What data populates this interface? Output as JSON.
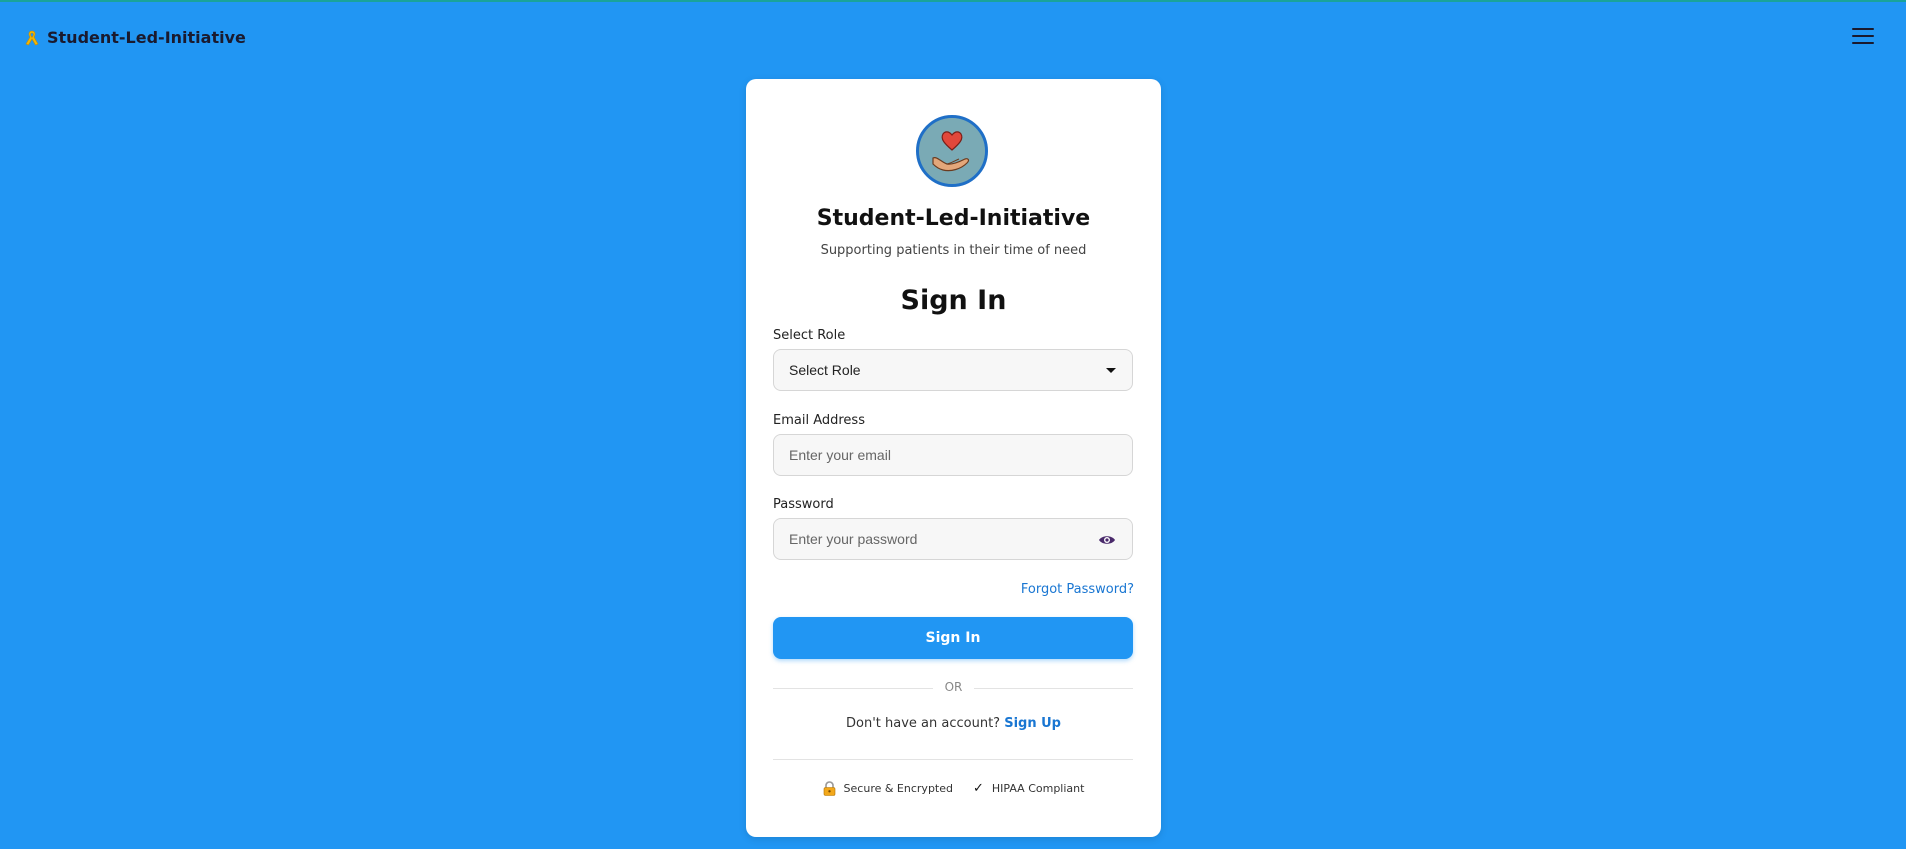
{
  "header": {
    "brand_name": "Student-Led-Initiative",
    "brand_icon": "awareness-ribbon-icon",
    "menu_icon": "hamburger-menu-icon"
  },
  "card": {
    "logo_icon": "heart-in-hand-icon",
    "app_title": "Student-Led-Initiative",
    "tagline": "Supporting patients in their time of need",
    "heading": "Sign In"
  },
  "form": {
    "role": {
      "label": "Select Role",
      "selected": "Select Role"
    },
    "email": {
      "label": "Email Address",
      "placeholder": "Enter your email",
      "value": ""
    },
    "password": {
      "label": "Password",
      "placeholder": "Enter your password",
      "value": "",
      "toggle_icon": "eye-icon"
    },
    "forgot_link": "Forgot Password?",
    "submit_label": "Sign In"
  },
  "alt": {
    "or_text": "OR",
    "signup_prompt": "Don't have an account?",
    "signup_link": "Sign Up"
  },
  "badges": {
    "secure": {
      "icon": "lock-icon",
      "text": "Secure & Encrypted"
    },
    "hipaa": {
      "icon": "check-icon",
      "text": "HIPAA Compliant"
    }
  },
  "colors": {
    "background": "#2196f3",
    "primary": "#2196f3",
    "link": "#1976d2"
  }
}
